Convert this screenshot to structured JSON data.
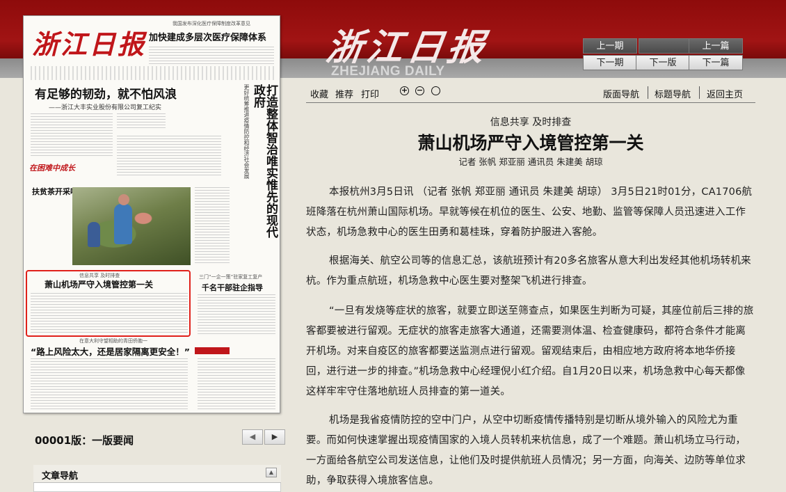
{
  "header": {
    "logo_cn": "浙江日报",
    "logo_en": "ZHEJIANG DAILY",
    "nav": {
      "prev_issue": "上一期",
      "prev_article": "上一篇",
      "next_issue": "下一期",
      "next_page": "下一版",
      "next_article": "下一篇"
    }
  },
  "thumbnail": {
    "logo": "浙江日报",
    "top_kicker": "我国发布深化医疗保障制度改革意见",
    "top_headline": "加快建成多层次医疗保障体系",
    "headline_left": "有足够的韧劲，就不怕风浪",
    "headline_left_sub": "——浙江大丰实业股份有限公司复工纪实",
    "vertical_headline": "打造整体智治唯实惟先的现代政府",
    "vertical_sub": "更好统筹推进疫情防控和经济社会发展",
    "red_strip": "在困难中成长",
    "photo_title": "扶贫茶开采啦",
    "highlight_kicker": "信息共享 及时排查",
    "highlight_title": "萧山机场严守入境管控第一关",
    "right_box_kicker": "三门“一企一策”驻家复工复产",
    "right_box_title": "千名干部驻企指导",
    "bottom_kicker": "在意大利守望相助的青田侨胞一",
    "bottom_title": "“路上风险太大，还是居家隔离更安全！”"
  },
  "left_panel": {
    "edition": "00001版：一版要闻",
    "pager_prev": "◀",
    "pager_next": "▶",
    "nav_title": "文章导航",
    "nav_collapse": "▲"
  },
  "toolbar": {
    "collect": "收藏",
    "recommend": "推荐",
    "print": "打印",
    "zoom_in": "+",
    "zoom_out": "−",
    "zoom_reset": "",
    "page_nav": "版面导航",
    "title_nav": "标题导航",
    "home": "返回主页"
  },
  "article": {
    "kicker": "信息共享 及时排查",
    "title": "萧山机场严守入境管控第一关",
    "byline": "记者 张帆 郑亚丽 通讯员 朱建美 胡琼",
    "paragraphs": [
      "本报杭州3月5日讯 （记者 张帆 郑亚丽 通讯员 朱建美 胡琼） 3月5日21时01分，CA1706航班降落在杭州萧山国际机场。早就等候在机位的医生、公安、地勤、监管等保障人员迅速进入工作状态，机场急救中心的医生田勇和葛桂珠，穿着防护服进入客舱。",
      "根据海关、航空公司等的信息汇总，该航班预计有20多名旅客从意大利出发经其他机场转机来杭。作为重点航班，机场急救中心医生要对整架飞机进行排查。",
      "“一旦有发烧等症状的旅客，就要立即送至筛查点，如果医生判断为可疑，其座位前后三排的旅客都要被进行留观。无症状的旅客走旅客大通道，还需要测体温、检查健康码，都符合条件才能离开机场。对来自疫区的旅客都要送监测点进行留观。留观结束后，由相应地方政府将本地华侨接回，进行进一步的排查。”机场急救中心经理倪小红介绍。自1月20日以来，机场急救中心每天都像这样牢牢守住落地航班人员排查的第一道关。",
      "机场是我省疫情防控的空中门户，从空中切断疫情传播特别是切断从境外输入的风险尤为重要。而如何快速掌握出现疫情国家的入境人员转机来杭信息，成了一个难题。萧山机场立马行动，一方面给各航空公司发送信息，让他们及时提供航班人员情况；另一方面，向海关、边防等单位求助，争取获得入境旅客信息。"
    ]
  }
}
